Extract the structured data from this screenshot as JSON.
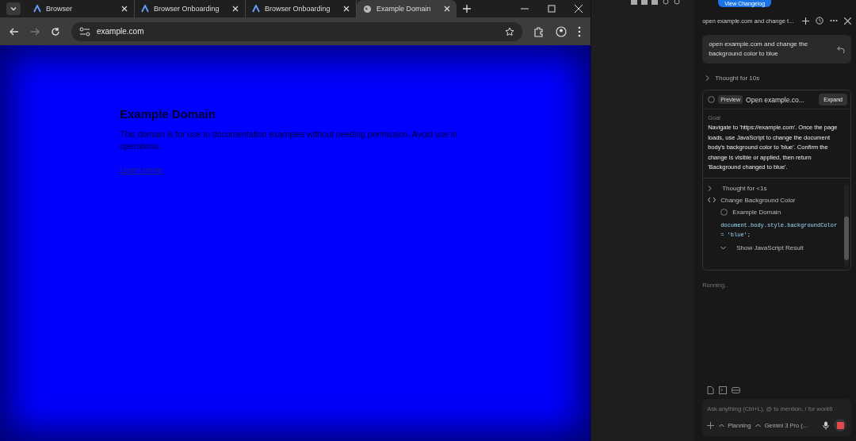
{
  "browser": {
    "tabs": [
      {
        "title": "Browser",
        "kind": "app",
        "selected": false
      },
      {
        "title": "Browser Onboarding",
        "kind": "app",
        "selected": false
      },
      {
        "title": "Browser Onboarding",
        "kind": "app",
        "selected": false
      },
      {
        "title": "Example Domain",
        "kind": "globe",
        "selected": true
      }
    ],
    "address": "example.com",
    "page": {
      "heading": "Example Domain",
      "paragraph": "This domain is for use in documentation examples without needing permission. Avoid use in operations.",
      "link": "Learn more"
    }
  },
  "top_strip": {
    "button": "View Changelog"
  },
  "agent_panel": {
    "title": "open example.com and change t...",
    "user_message": "open example.com and change the background color to blue",
    "thought": "Thought for 10s",
    "step": {
      "badge": "Preview",
      "title": "Open example.co...",
      "expand": "Expand",
      "goal_label": "Goal",
      "goal": "Navigate to 'https://example.com'. Once the page loads, use JavaScript to change the document body's background color to 'blue'. Confirm the change is visible or applied, then return 'Background changed to blue'.",
      "log": [
        {
          "kind": "thought",
          "text": "Thought for <1s"
        },
        {
          "kind": "action",
          "text": "Change Background Color"
        },
        {
          "kind": "page",
          "text": "Example Domain"
        },
        {
          "kind": "code",
          "text": "document.body.style.backgroundColor = 'blue';"
        },
        {
          "kind": "toggle",
          "text": "Show JavaScript Result"
        }
      ]
    },
    "status": "Running..",
    "input": {
      "placeholder": "Ask anything (Ctrl+L), @ to mention, / for workfl"
    },
    "mode": "Planning",
    "model": "Gemini 3 Pro (..."
  }
}
